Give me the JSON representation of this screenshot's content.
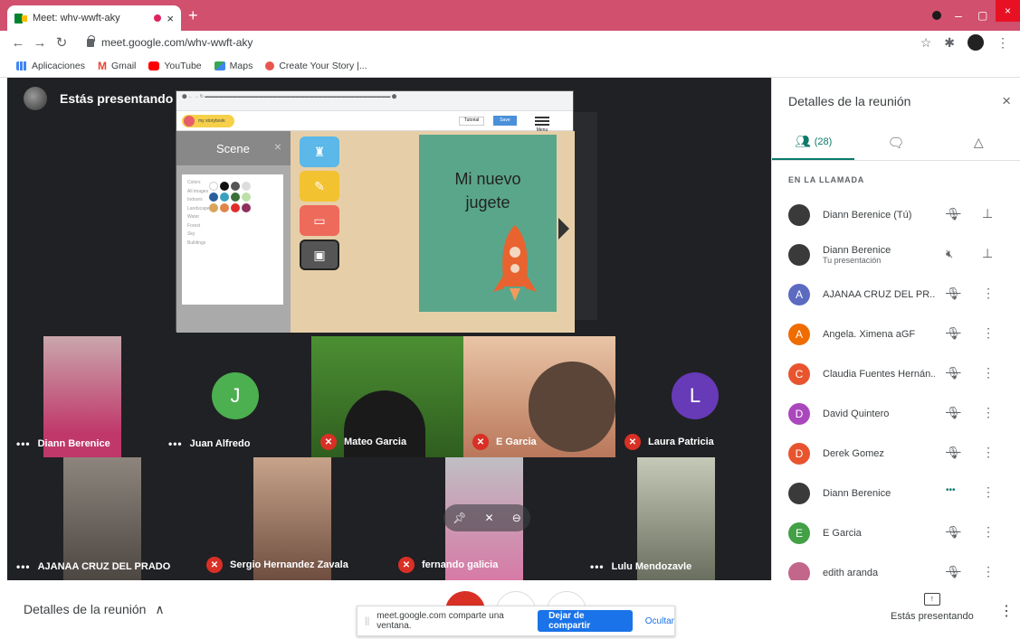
{
  "browser": {
    "tab_title": "Meet: whv-wwft-aky",
    "tab_close": "×",
    "new_tab": "+",
    "url": "meet.google.com/whv-wwft-aky",
    "window": {
      "minimize": "–",
      "maximize": "▢",
      "close": "×"
    },
    "bookmarks": [
      {
        "label": "Aplicaciones",
        "color": "#4285f4"
      },
      {
        "label": "Gmail",
        "color": "#ea4335"
      },
      {
        "label": "YouTube",
        "color": "#ff0000"
      },
      {
        "label": "Maps",
        "color": "#34a853"
      },
      {
        "label": "Create Your Story |...",
        "color": "#e8554e"
      }
    ]
  },
  "stage": {
    "presenting_label": "Estás presentando",
    "screen": {
      "storybook_label": "my storybook",
      "tutorial_label": "Tutorial",
      "save_label": "Save",
      "menu_label": "Menu",
      "scene_title": "Scene",
      "scene_close": "×",
      "scene_categories": [
        "Colors",
        "All images",
        "Indoors",
        "Landscape",
        "Water",
        "Forest",
        "Sky",
        "Buildings"
      ],
      "page_text_line1": "Mi nuevo",
      "page_text_line2": "jugete"
    },
    "tiles_row1": [
      {
        "name": "Diann Berenice",
        "status": "dots",
        "bg": "#b9a3a8"
      },
      {
        "name": "Juan Alfredo",
        "status": "dots",
        "avatar": "J",
        "avatar_color": "#4caf50",
        "bg": "#202124"
      },
      {
        "name": "Mateo Garcia",
        "status": "muted",
        "bg": "#3f7d2a"
      },
      {
        "name": "E Garcia",
        "status": "muted",
        "bg": "#c98a6a"
      },
      {
        "name": "Laura Patricia",
        "status": "muted",
        "avatar": "L",
        "avatar_color": "#673ab7",
        "bg": "#202124"
      }
    ],
    "tiles_row2": [
      {
        "name": "AJANAA CRUZ DEL PRADO",
        "status": "dots",
        "bg": "#6e6a66"
      },
      {
        "name": "Sergio Hernandez Zavala",
        "status": "muted",
        "bg": "#9c7a68"
      },
      {
        "name": "fernando galicia",
        "status": "muted",
        "bg": "#a7a6ab"
      },
      {
        "name": "Lulu Mendozavle",
        "status": "dots",
        "bg": "#8a8f7e"
      }
    ]
  },
  "panel": {
    "title": "Detalles de la reunión",
    "close": "×",
    "people_count": "(28)",
    "section_label": "EN LA LLAMADA",
    "people": [
      {
        "name": "Diann Berenice (Tú)",
        "sub": "",
        "avatar": "",
        "color": "#3a3a3a",
        "mic": "muted",
        "action": "pin"
      },
      {
        "name": "Diann Berenice",
        "sub": "Tu presentación",
        "avatar": "",
        "color": "#3a3a3a",
        "mic": "sound-off",
        "action": "pin"
      },
      {
        "name": "AJANAA CRUZ DEL PR...",
        "sub": "",
        "avatar": "A",
        "color": "#5c6bc0",
        "mic": "muted",
        "action": "more"
      },
      {
        "name": "Angela. Ximena aGF",
        "sub": "",
        "avatar": "A",
        "color": "#ef6c00",
        "mic": "muted",
        "action": "more"
      },
      {
        "name": "Claudia Fuentes Hernán...",
        "sub": "",
        "avatar": "C",
        "color": "#e8542e",
        "mic": "muted",
        "action": "more"
      },
      {
        "name": "David Quintero",
        "sub": "",
        "avatar": "D",
        "color": "#ab47bc",
        "mic": "muted",
        "action": "more"
      },
      {
        "name": "Derek Gomez",
        "sub": "",
        "avatar": "D",
        "color": "#e8542e",
        "mic": "muted",
        "action": "more"
      },
      {
        "name": "Diann Berenice",
        "sub": "",
        "avatar": "",
        "color": "#3a3a3a",
        "mic": "talking",
        "action": "more"
      },
      {
        "name": "E Garcia",
        "sub": "",
        "avatar": "E",
        "color": "#43a047",
        "mic": "muted",
        "action": "more"
      },
      {
        "name": "edith aranda",
        "sub": "",
        "avatar": "",
        "color": "#c2668a",
        "mic": "muted",
        "action": "more"
      }
    ]
  },
  "bottom": {
    "details_label": "Detalles de la reunión",
    "share_notice": "meet.google.com comparte una ventana.",
    "stop_sharing": "Dejar de compartir",
    "hide": "Ocultar",
    "presenting": "Estás presentando"
  }
}
